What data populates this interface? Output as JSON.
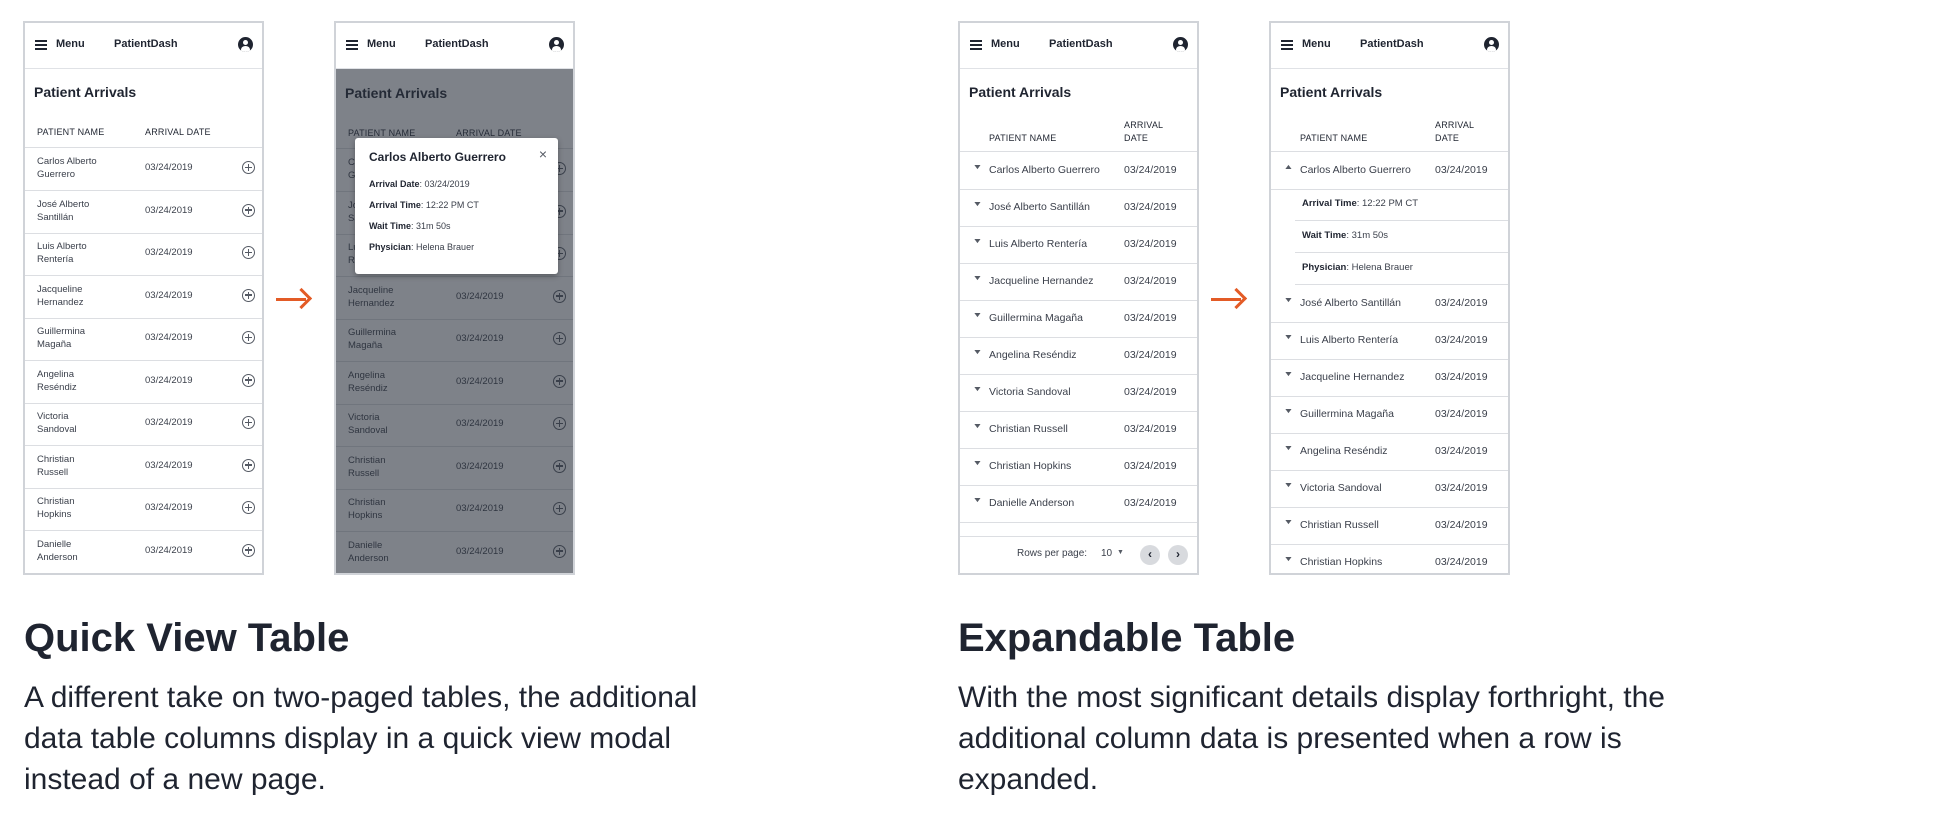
{
  "app": {
    "menu_label": "Menu",
    "brand": "PatientDash",
    "table_title": "Patient Arrivals",
    "col_name": "PATIENT NAME",
    "col_date": "ARRIVAL DATE",
    "col_date_line1": "ARRIVAL",
    "col_date_line2": "DATE"
  },
  "quick_view": {
    "rows": [
      {
        "name_l1": "Carlos Alberto",
        "name_l2": "Guerrero",
        "date": "03/24/2019"
      },
      {
        "name_l1": "José Alberto",
        "name_l2": "Santillán",
        "date": "03/24/2019"
      },
      {
        "name_l1": "Luis Alberto",
        "name_l2": "Rentería",
        "date": "03/24/2019"
      },
      {
        "name_l1": "Jacqueline",
        "name_l2": "Hernandez",
        "date": "03/24/2019"
      },
      {
        "name_l1": "Guillermina",
        "name_l2": "Magaña",
        "date": "03/24/2019"
      },
      {
        "name_l1": "Angelina",
        "name_l2": "Reséndiz",
        "date": "03/24/2019"
      },
      {
        "name_l1": "Victoria",
        "name_l2": "Sandoval",
        "date": "03/24/2019"
      },
      {
        "name_l1": "Christian",
        "name_l2": "Russell",
        "date": "03/24/2019"
      },
      {
        "name_l1": "Christian",
        "name_l2": "Hopkins",
        "date": "03/24/2019"
      },
      {
        "name_l1": "Danielle",
        "name_l2": "Anderson",
        "date": "03/24/2019"
      }
    ],
    "modal": {
      "title": "Carlos Alberto Guerrero",
      "close": "×",
      "arrival_date_label": "Arrival Date",
      "arrival_date": ": 03/24/2019",
      "arrival_time_label": "Arrival Time",
      "arrival_time": ": 12:22 PM CT",
      "wait_time_label": "Wait Time",
      "wait_time": ": 31m 50s",
      "physician_label": "Physician",
      "physician": ": Helena Brauer"
    },
    "heading": "Quick View Table",
    "description": "A different take on two-paged tables, the additional data table columns display in a quick view modal instead of a new page."
  },
  "expandable": {
    "rows": [
      {
        "name": "Carlos Alberto Guerrero",
        "date": "03/24/2019"
      },
      {
        "name": "José Alberto Santillán",
        "date": "03/24/2019"
      },
      {
        "name": "Luis Alberto Rentería",
        "date": "03/24/2019"
      },
      {
        "name": "Jacqueline Hernandez",
        "date": "03/24/2019"
      },
      {
        "name": "Guillermina Magaña",
        "date": "03/24/2019"
      },
      {
        "name": "Angelina Reséndiz",
        "date": "03/24/2019"
      },
      {
        "name": "Victoria Sandoval",
        "date": "03/24/2019"
      },
      {
        "name": "Christian Russell",
        "date": "03/24/2019"
      },
      {
        "name": "Christian Hopkins",
        "date": "03/24/2019"
      },
      {
        "name": "Danielle Anderson",
        "date": "03/24/2019"
      }
    ],
    "pager": {
      "rows_per_page_label": "Rows per page:",
      "rows_per_page_value": "10",
      "prev": "‹",
      "next": "›"
    },
    "details": [
      {
        "label": "Arrival Time",
        "value": ": 12:22 PM CT"
      },
      {
        "label": "Wait Time",
        "value": ": 31m 50s"
      },
      {
        "label": "Physician",
        "value": ": Helena Brauer"
      }
    ],
    "heading": "Expandable Table",
    "description": "With the most significant details display forthright, the additional column data is presented when a row is expanded."
  },
  "colors": {
    "accent_arrow": "#e35b26",
    "text": "#1f2430",
    "overlay": "#282e3a"
  }
}
